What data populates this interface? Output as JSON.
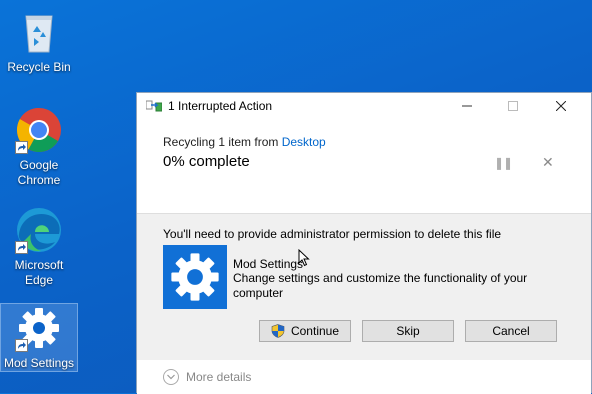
{
  "desktop": {
    "icons": [
      {
        "label": "Recycle Bin"
      },
      {
        "label": "Google Chrome"
      },
      {
        "label": "Microsoft Edge"
      },
      {
        "label": "Mod Settings"
      }
    ]
  },
  "dialog": {
    "title": "1 Interrupted Action",
    "progress": {
      "recycling_text": "Recycling 1 item from ",
      "source_link": "Desktop",
      "complete_text": "0% complete",
      "percent": 0
    },
    "permission_text": "You'll need to provide administrator permission to delete this file",
    "file": {
      "name": "Mod Settings",
      "description": "Change settings and customize the functionality of your computer"
    },
    "buttons": {
      "continue": "Continue",
      "skip": "Skip",
      "cancel": "Cancel"
    },
    "more_details": "More details"
  },
  "colors": {
    "desktop_bg": "#0b63c9",
    "link": "#0066cc",
    "file_icon_bg": "#1170d6"
  }
}
